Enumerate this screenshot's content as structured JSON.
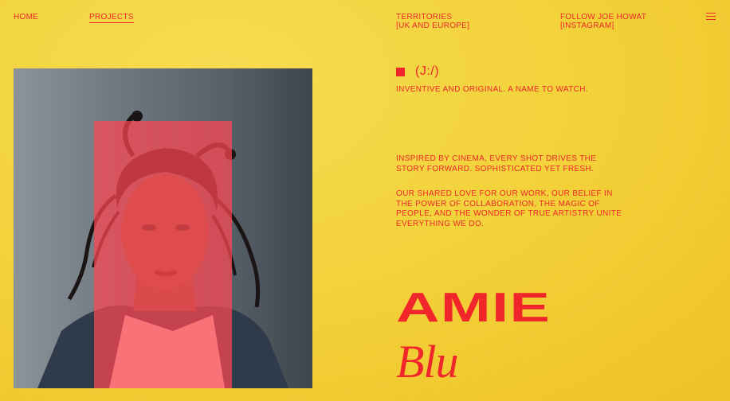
{
  "nav": {
    "home": "HOME",
    "projects": "PROJECTS",
    "territories_line1": "TERRITORIES",
    "territories_line2": "[UK AND EUROPE]",
    "follow_line1": "FOLLOW JOE HOWAT",
    "follow_line2": "[INSTAGRAM]",
    "menu_icon": "hamburger-icon"
  },
  "hero": {
    "marker_label": "(J:/)",
    "tagline": "INVENTIVE AND ORIGINAL. A NAME TO WATCH.",
    "paragraph1": "INSPIRED BY CINEMA, EVERY SHOT DRIVES THE STORY FORWARD. SOPHISTICATED YET FRESH.",
    "paragraph2": "OUR SHARED LOVE FOR OUR WORK, OUR BELIEF IN THE POWER OF COLLABORATION, THE MAGIC OF PEOPLE, AND THE WONDER OF TRUE ARTISTRY UNITE EVERYTHING WE DO.",
    "name_first": "AMIE",
    "name_last": "Blu"
  },
  "colors": {
    "background": "#f3d33c",
    "accent": "#f0262a",
    "overlay": "#ff4650"
  }
}
